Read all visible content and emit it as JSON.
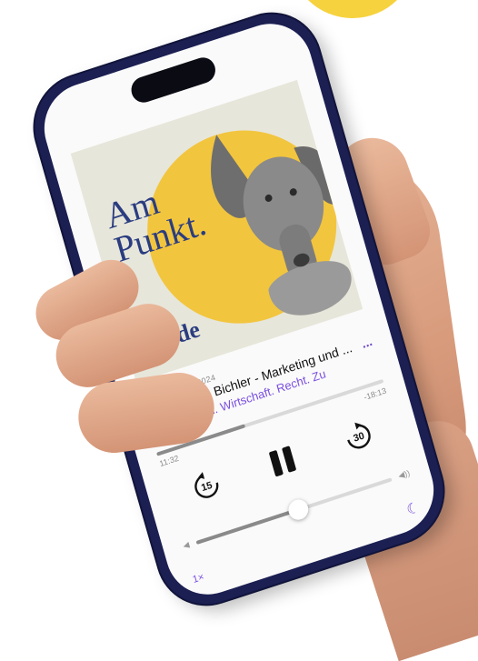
{
  "artwork": {
    "title": "Am\nPunkt.",
    "brand": "Linde"
  },
  "episode": {
    "date": "27. FEBRUAR 2024",
    "title": "- Jacqueline Bichler - Marketing und ...",
    "more_label": "...",
    "show": "nkt - Steuern. Wirtschaft. Recht. Zu"
  },
  "playback": {
    "elapsed": "11:32",
    "remaining": "-18:13",
    "progress": 0.39,
    "skip_back_label": "15",
    "skip_forward_label": "30",
    "volume": 0.52,
    "speed": "1×"
  },
  "colors": {
    "accent": "#7b4fe0",
    "phone_frame": "#1b1f52",
    "art_sun": "#f2c53e",
    "art_text": "#2b3d80"
  }
}
